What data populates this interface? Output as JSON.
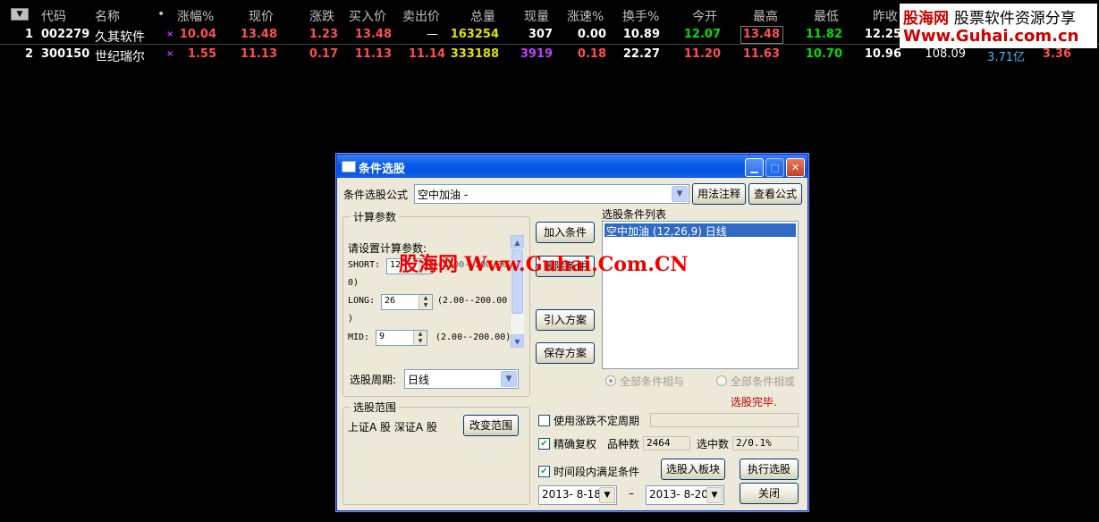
{
  "table": {
    "headers": [
      "代码",
      "名称",
      "•",
      "涨幅%",
      "现价",
      "涨跌",
      "买入价",
      "卖出价",
      "总量",
      "现量",
      "涨速%",
      "换手%",
      "今开",
      "最高",
      "最低",
      "昨收"
    ],
    "rows": [
      {
        "idx": "1",
        "code": "002279",
        "name": "久其软件",
        "mark": "×",
        "pct": "10.04",
        "price": "13.48",
        "chg": "1.23",
        "bid": "13.48",
        "ask": "—",
        "vol": "163254",
        "cur": "307",
        "speed": "0.00",
        "turn": "10.89",
        "open": "12.07",
        "high": "13.48",
        "low": "11.82",
        "prev": "12.25",
        "x1": "",
        "x2": "",
        "x3": ""
      },
      {
        "idx": "2",
        "code": "300150",
        "name": "世纪瑞尔",
        "mark": "×",
        "pct": "1.55",
        "price": "11.13",
        "chg": "0.17",
        "bid": "11.13",
        "ask": "11.14",
        "vol": "333188",
        "cur": "3919",
        "speed": "0.18",
        "turn": "22.27",
        "open": "11.20",
        "high": "11.63",
        "low": "10.70",
        "prev": "10.96",
        "x1": "108.09",
        "x2": "3.71亿",
        "x3": "3.36"
      }
    ]
  },
  "watermark": {
    "logo": "股海网",
    "slogan": "股票软件资源分享",
    "url": "Www.Guhai.com.cn",
    "center_text": "股海网 Www.Guhai.Com.CN"
  },
  "dialog": {
    "title": "条件选股",
    "formula_label": "条件选股公式",
    "formula_value": "空中加油 -",
    "btn_usage": "用法注释",
    "btn_view": "查看公式",
    "params_group": "计算参数",
    "params_prompt": "请设置计算参数:",
    "short_label": "SHORT:",
    "short_value": "12",
    "short_range": "(2.00--200.00)",
    "short_range_tail": "0)",
    "long_label": "LONG:",
    "long_value": "26",
    "long_range": "(2.00--200.00",
    "long_range_tail": ")",
    "mid_label": "MID:",
    "mid_value": "9",
    "mid_range": "(2.00--200.00)",
    "period_label": "选股周期:",
    "period_value": "日线",
    "btn_add": "加入条件",
    "btn_delete": "删除条件",
    "btn_import": "引入方案",
    "btn_save": "保存方案",
    "list_label": "选股条件列表",
    "list_items": [
      "空中加油 (12,26,9) 日线"
    ],
    "radio_and": "全部条件相与",
    "radio_or": "全部条件相或",
    "status_text": "选股完毕.",
    "range_group": "选股范围",
    "range_value": "上证A 股 深证A 股",
    "btn_change_range": "改变范围",
    "chk_uncertain": "使用涨跌不定周期",
    "chk_restore": "精确复权",
    "count_label": "品种数",
    "count_value": "2464",
    "selected_label": "选中数",
    "selected_value": "2/0.1%",
    "chk_timespan": "时间段内满足条件",
    "btn_to_block": "选股入板块",
    "btn_execute": "执行选股",
    "date_from": "2013- 8-18",
    "date_dash": "–",
    "date_to": "2013- 8-20",
    "btn_close": "关闭"
  },
  "colors": {
    "up": "#ff5050",
    "flat": "#ffffff",
    "green": "#00e000",
    "magenta": "#c040ff",
    "yellow": "#e0e000",
    "header": "#c0c0c0",
    "cyan": "#40c0ff"
  }
}
